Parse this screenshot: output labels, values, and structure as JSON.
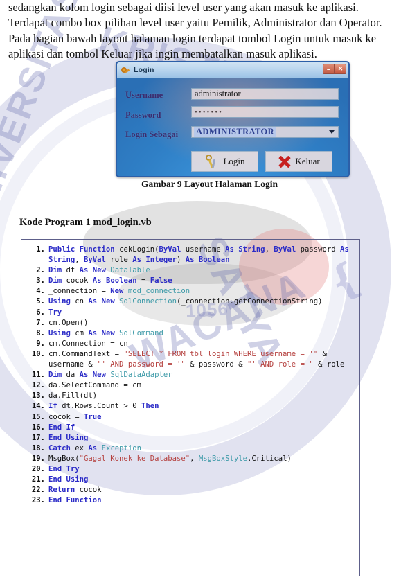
{
  "document": {
    "paragraph_lines": [
      "sedangkan kolom login sebagai diisi level user yang akan masuk ke aplikasi.",
      "Terdapat combo box pilihan level user yaitu Pemilik, Administrator dan Operator.",
      "Pada bagian bawah  layout halaman login terdapat tombol Login untuk masuk ke",
      "aplikasi dan tombol Keluar jika ingin membatalkan masuk aplikasi."
    ],
    "figure_caption": "Gambar 9 Layout Halaman Login",
    "code_heading": "Kode Program 1 mod_login.vb"
  },
  "login_dialog": {
    "title": "Login",
    "app_icon": "keys-icon",
    "minimize_label": "–",
    "close_label": "✕",
    "fields": [
      {
        "label": "Username",
        "value": "administrator"
      },
      {
        "label": "Password",
        "value": "•••••••"
      },
      {
        "label": "Login Sebagai",
        "value": "ADMINISTRATOR"
      }
    ],
    "buttons": [
      {
        "label": "Login",
        "icon": "keys-icon"
      },
      {
        "label": "Keluar",
        "icon": "red-x-icon"
      }
    ]
  },
  "watermark": {
    "top": "UNIVERSITAS",
    "right": "KRISTEN",
    "bottom_right": "SATYA",
    "bottom": "WACANA",
    "number": "1056"
  },
  "code": {
    "language": "vb",
    "lines": [
      {
        "n": "1.",
        "tokens": [
          {
            "t": "Public ",
            "c": "kw"
          },
          {
            "t": "Function ",
            "c": "kw"
          },
          {
            "t": "cekLogin(",
            "c": "pl"
          },
          {
            "t": "ByVal ",
            "c": "kw"
          },
          {
            "t": "username ",
            "c": "pl"
          },
          {
            "t": "As ",
            "c": "kw"
          },
          {
            "t": "String",
            "c": "kw"
          },
          {
            "t": ", ",
            "c": "pl"
          },
          {
            "t": "ByVal ",
            "c": "kw"
          },
          {
            "t": "password ",
            "c": "pl"
          },
          {
            "t": "As ",
            "c": "kw"
          },
          {
            "t": "String",
            "c": "kw"
          },
          {
            "t": ", ",
            "c": "pl"
          },
          {
            "t": "ByVal ",
            "c": "kw"
          },
          {
            "t": "role ",
            "c": "pl"
          },
          {
            "t": "As ",
            "c": "kw"
          },
          {
            "t": "Integer",
            "c": "kw"
          },
          {
            "t": ") ",
            "c": "pl"
          },
          {
            "t": "As ",
            "c": "kw"
          },
          {
            "t": "Boolean",
            "c": "kw"
          }
        ]
      },
      {
        "n": "2.",
        "tokens": [
          {
            "t": "Dim ",
            "c": "kw"
          },
          {
            "t": "dt ",
            "c": "pl"
          },
          {
            "t": "As ",
            "c": "kw"
          },
          {
            "t": "New ",
            "c": "kw"
          },
          {
            "t": "DataTable",
            "c": "typ"
          }
        ]
      },
      {
        "n": "3.",
        "tokens": [
          {
            "t": "Dim ",
            "c": "kw"
          },
          {
            "t": "cocok ",
            "c": "pl"
          },
          {
            "t": "As ",
            "c": "kw"
          },
          {
            "t": "Boolean ",
            "c": "kw"
          },
          {
            "t": "= ",
            "c": "pl"
          },
          {
            "t": "False",
            "c": "kw"
          }
        ]
      },
      {
        "n": "4.",
        "tokens": [
          {
            "t": "_connection = ",
            "c": "pl"
          },
          {
            "t": "New ",
            "c": "kw"
          },
          {
            "t": "mod_connection",
            "c": "typ"
          }
        ]
      },
      {
        "n": "5.",
        "tokens": [
          {
            "t": "Using ",
            "c": "kw"
          },
          {
            "t": "cn ",
            "c": "pl"
          },
          {
            "t": "As ",
            "c": "kw"
          },
          {
            "t": "New ",
            "c": "kw"
          },
          {
            "t": "SqlConnection",
            "c": "typ"
          },
          {
            "t": "(_connection.getConnectionString)",
            "c": "pl"
          }
        ]
      },
      {
        "n": "6.",
        "tokens": [
          {
            "t": "Try",
            "c": "kw"
          }
        ]
      },
      {
        "n": "7.",
        "tokens": [
          {
            "t": "cn.Open()",
            "c": "pl"
          }
        ]
      },
      {
        "n": "8.",
        "tokens": [
          {
            "t": "Using ",
            "c": "kw"
          },
          {
            "t": "cm ",
            "c": "pl"
          },
          {
            "t": "As ",
            "c": "kw"
          },
          {
            "t": "New ",
            "c": "kw"
          },
          {
            "t": "SqlCommand",
            "c": "typ"
          }
        ]
      },
      {
        "n": "9.",
        "tokens": [
          {
            "t": "cm.Connection = cn",
            "c": "pl"
          }
        ]
      },
      {
        "n": "10.",
        "tokens": [
          {
            "t": "cm.CommandText = ",
            "c": "pl"
          },
          {
            "t": "\"SELECT * FROM tbl_login WHERE username = '\"",
            "c": "str"
          },
          {
            "t": " & username & ",
            "c": "pl"
          },
          {
            "t": "\"' AND password = '\"",
            "c": "str"
          },
          {
            "t": " & password & ",
            "c": "pl"
          },
          {
            "t": "\"' AND role = \"",
            "c": "str"
          },
          {
            "t": " & role",
            "c": "pl"
          }
        ]
      },
      {
        "n": "11.",
        "tokens": [
          {
            "t": "Dim ",
            "c": "kw"
          },
          {
            "t": "da ",
            "c": "pl"
          },
          {
            "t": "As ",
            "c": "kw"
          },
          {
            "t": "New ",
            "c": "kw"
          },
          {
            "t": "SqlDataAdapter",
            "c": "typ"
          }
        ]
      },
      {
        "n": "12.",
        "tokens": [
          {
            "t": "da.SelectCommand = cm",
            "c": "pl"
          }
        ]
      },
      {
        "n": "13.",
        "tokens": [
          {
            "t": "da.Fill(dt)",
            "c": "pl"
          }
        ]
      },
      {
        "n": "14.",
        "tokens": [
          {
            "t": "If ",
            "c": "kw"
          },
          {
            "t": "dt.Rows.Count > 0 ",
            "c": "pl"
          },
          {
            "t": "Then",
            "c": "kw"
          }
        ]
      },
      {
        "n": "15.",
        "tokens": [
          {
            "t": "cocok = ",
            "c": "pl"
          },
          {
            "t": "True",
            "c": "kw"
          }
        ]
      },
      {
        "n": "16.",
        "tokens": [
          {
            "t": "End If",
            "c": "kw"
          }
        ]
      },
      {
        "n": "17.",
        "tokens": [
          {
            "t": "End Using",
            "c": "kw"
          }
        ]
      },
      {
        "n": "18.",
        "tokens": [
          {
            "t": "Catch ",
            "c": "kw"
          },
          {
            "t": "ex ",
            "c": "pl"
          },
          {
            "t": "As ",
            "c": "kw"
          },
          {
            "t": "Exception",
            "c": "typ"
          }
        ]
      },
      {
        "n": "19.",
        "tokens": [
          {
            "t": "MsgBox(",
            "c": "pl"
          },
          {
            "t": "\"Gagal Konek ke Database\"",
            "c": "str"
          },
          {
            "t": ", ",
            "c": "pl"
          },
          {
            "t": "MsgBoxStyle",
            "c": "typ"
          },
          {
            "t": ".Critical)",
            "c": "pl"
          }
        ]
      },
      {
        "n": "20.",
        "tokens": [
          {
            "t": "End Try",
            "c": "kw"
          }
        ]
      },
      {
        "n": "21.",
        "tokens": [
          {
            "t": "End Using",
            "c": "kw"
          }
        ]
      },
      {
        "n": "22.",
        "tokens": [
          {
            "t": "Return ",
            "c": "kw"
          },
          {
            "t": "cocok",
            "c": "pl"
          }
        ]
      },
      {
        "n": "23.",
        "tokens": [
          {
            "t": "End Function",
            "c": "kw"
          }
        ]
      }
    ]
  }
}
